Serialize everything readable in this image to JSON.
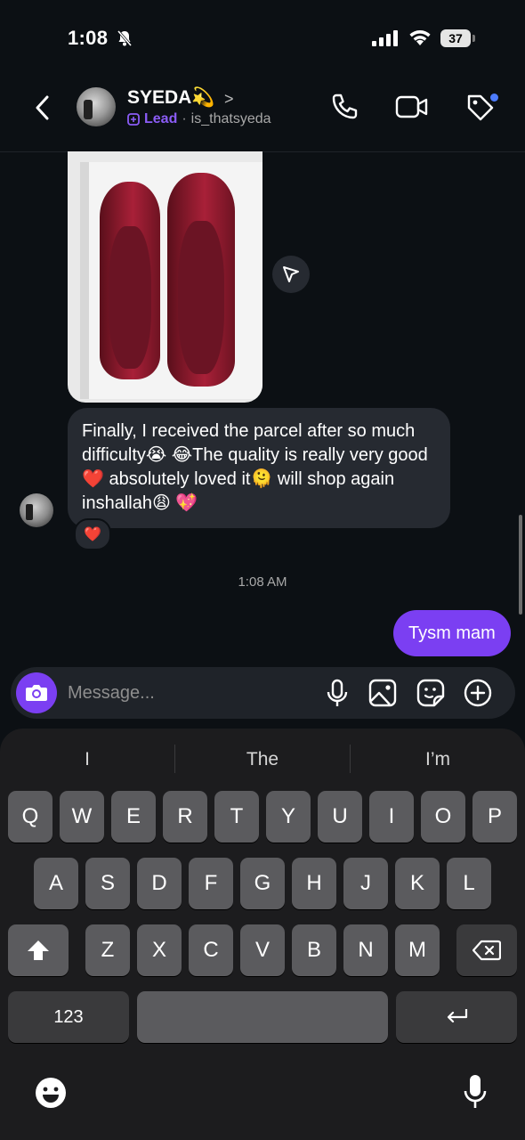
{
  "status_bar": {
    "time": "1:08",
    "battery": "37"
  },
  "header": {
    "contact_name": "SYEDA💫",
    "lead_label": "Lead",
    "separator": "·",
    "username": "is_thatsyeda",
    "chevron": ">"
  },
  "messages": {
    "incoming_text": "Finally, I received the parcel after so much difficulty😭 😂The quality is really very good ❤️ absolutely loved it🫠 will shop again inshallah😩 💖",
    "reaction": "❤️",
    "timestamp": "1:08 AM",
    "outgoing_text": "Tysm mam"
  },
  "composer": {
    "placeholder": "Message..."
  },
  "keyboard": {
    "suggestions": [
      "I",
      "The",
      "I’m"
    ],
    "row1": [
      "Q",
      "W",
      "E",
      "R",
      "T",
      "Y",
      "U",
      "I",
      "O",
      "P"
    ],
    "row2": [
      "A",
      "S",
      "D",
      "F",
      "G",
      "H",
      "J",
      "K",
      "L"
    ],
    "row3": [
      "Z",
      "X",
      "C",
      "V",
      "B",
      "N",
      "M"
    ],
    "numbers_key": "123"
  },
  "colors": {
    "background": "#0c1014",
    "accent_purple": "#7b3ff2",
    "lead_purple": "#8b5cf6",
    "bubble_gray": "#262a31",
    "notification_blue": "#4d7cfe"
  }
}
